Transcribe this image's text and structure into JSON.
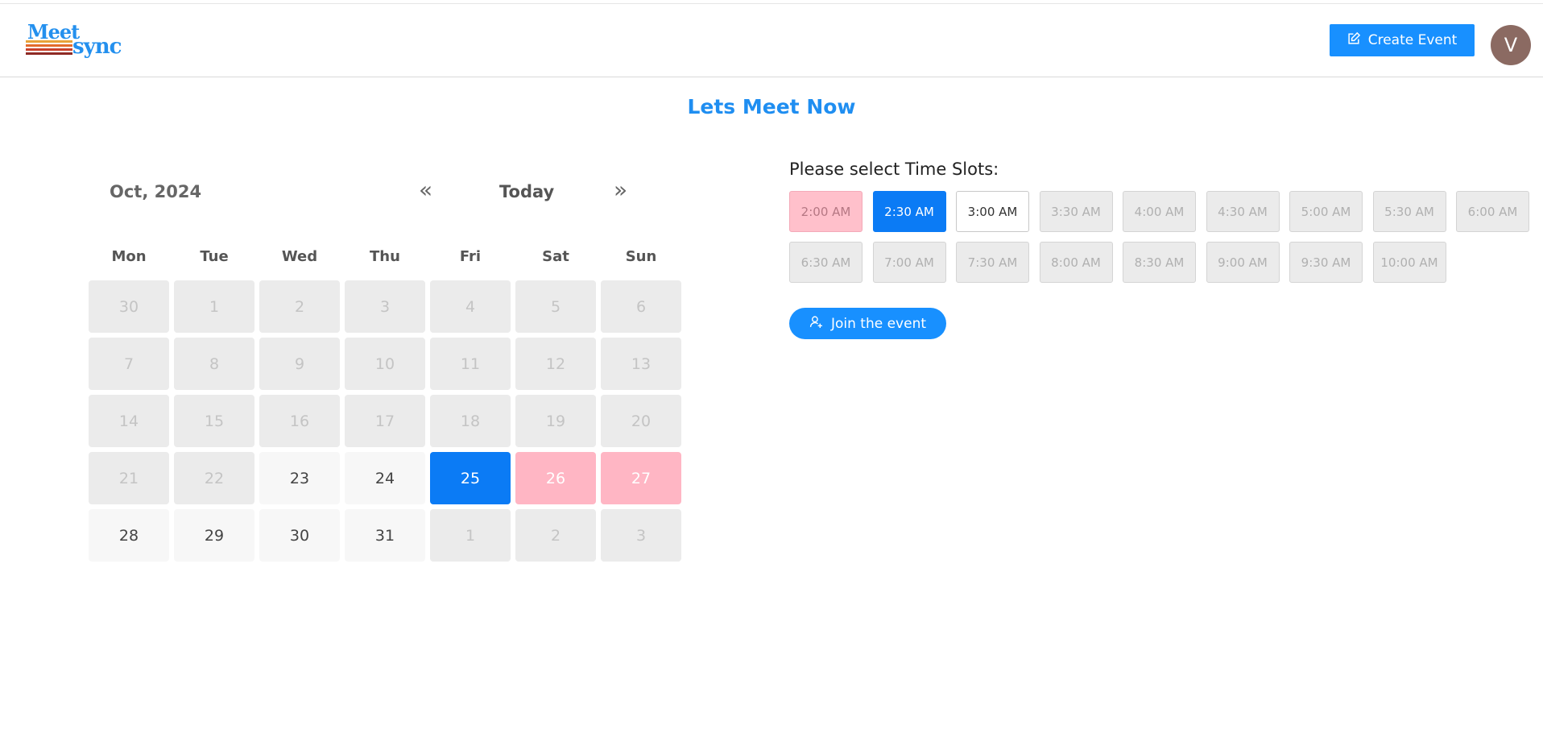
{
  "header": {
    "logo_line1": "Meet",
    "logo_line2": "sync",
    "create_label": "Create Event",
    "avatar_initial": "V"
  },
  "page": {
    "title": "Lets Meet Now"
  },
  "calendar": {
    "month_label": "Oct, 2024",
    "prev_icon": "«",
    "today_label": "Today",
    "next_icon": "»",
    "weekdays": [
      "Mon",
      "Tue",
      "Wed",
      "Thu",
      "Fri",
      "Sat",
      "Sun"
    ],
    "days": [
      {
        "label": "30",
        "state": "disabled"
      },
      {
        "label": "1",
        "state": "disabled"
      },
      {
        "label": "2",
        "state": "disabled"
      },
      {
        "label": "3",
        "state": "disabled"
      },
      {
        "label": "4",
        "state": "disabled"
      },
      {
        "label": "5",
        "state": "disabled"
      },
      {
        "label": "6",
        "state": "disabled"
      },
      {
        "label": "7",
        "state": "disabled"
      },
      {
        "label": "8",
        "state": "disabled"
      },
      {
        "label": "9",
        "state": "disabled"
      },
      {
        "label": "10",
        "state": "disabled"
      },
      {
        "label": "11",
        "state": "disabled"
      },
      {
        "label": "12",
        "state": "disabled"
      },
      {
        "label": "13",
        "state": "disabled"
      },
      {
        "label": "14",
        "state": "disabled"
      },
      {
        "label": "15",
        "state": "disabled"
      },
      {
        "label": "16",
        "state": "disabled"
      },
      {
        "label": "17",
        "state": "disabled"
      },
      {
        "label": "18",
        "state": "disabled"
      },
      {
        "label": "19",
        "state": "disabled"
      },
      {
        "label": "20",
        "state": "disabled"
      },
      {
        "label": "21",
        "state": "disabled"
      },
      {
        "label": "22",
        "state": "disabled"
      },
      {
        "label": "23",
        "state": "normal"
      },
      {
        "label": "24",
        "state": "normal"
      },
      {
        "label": "25",
        "state": "selected"
      },
      {
        "label": "26",
        "state": "marked"
      },
      {
        "label": "27",
        "state": "marked"
      },
      {
        "label": "28",
        "state": "normal"
      },
      {
        "label": "29",
        "state": "normal"
      },
      {
        "label": "30",
        "state": "normal"
      },
      {
        "label": "31",
        "state": "normal"
      },
      {
        "label": "1",
        "state": "disabled"
      },
      {
        "label": "2",
        "state": "disabled"
      },
      {
        "label": "3",
        "state": "disabled"
      }
    ]
  },
  "slots": {
    "label": "Please select Time Slots:",
    "items": [
      {
        "label": "2:00 AM",
        "state": "marked"
      },
      {
        "label": "2:30 AM",
        "state": "selected"
      },
      {
        "label": "3:00 AM",
        "state": "available"
      },
      {
        "label": "3:30 AM",
        "state": "disabled"
      },
      {
        "label": "4:00 AM",
        "state": "disabled"
      },
      {
        "label": "4:30 AM",
        "state": "disabled"
      },
      {
        "label": "5:00 AM",
        "state": "disabled"
      },
      {
        "label": "5:30 AM",
        "state": "disabled"
      },
      {
        "label": "6:00 AM",
        "state": "disabled"
      },
      {
        "label": "6:30 AM",
        "state": "disabled"
      },
      {
        "label": "7:00 AM",
        "state": "disabled"
      },
      {
        "label": "7:30 AM",
        "state": "disabled"
      },
      {
        "label": "8:00 AM",
        "state": "disabled"
      },
      {
        "label": "8:30 AM",
        "state": "disabled"
      },
      {
        "label": "9:00 AM",
        "state": "disabled"
      },
      {
        "label": "9:30 AM",
        "state": "disabled"
      },
      {
        "label": "10:00 AM",
        "state": "disabled"
      }
    ]
  },
  "join": {
    "label": "Join the event"
  },
  "colors": {
    "accent": "#1890ff",
    "selected": "#0b7bf5",
    "marked": "#ffb6c4",
    "disabled": "#ebebeb",
    "title": "#1f8ef1",
    "avatar_bg": "#8b6a62"
  }
}
